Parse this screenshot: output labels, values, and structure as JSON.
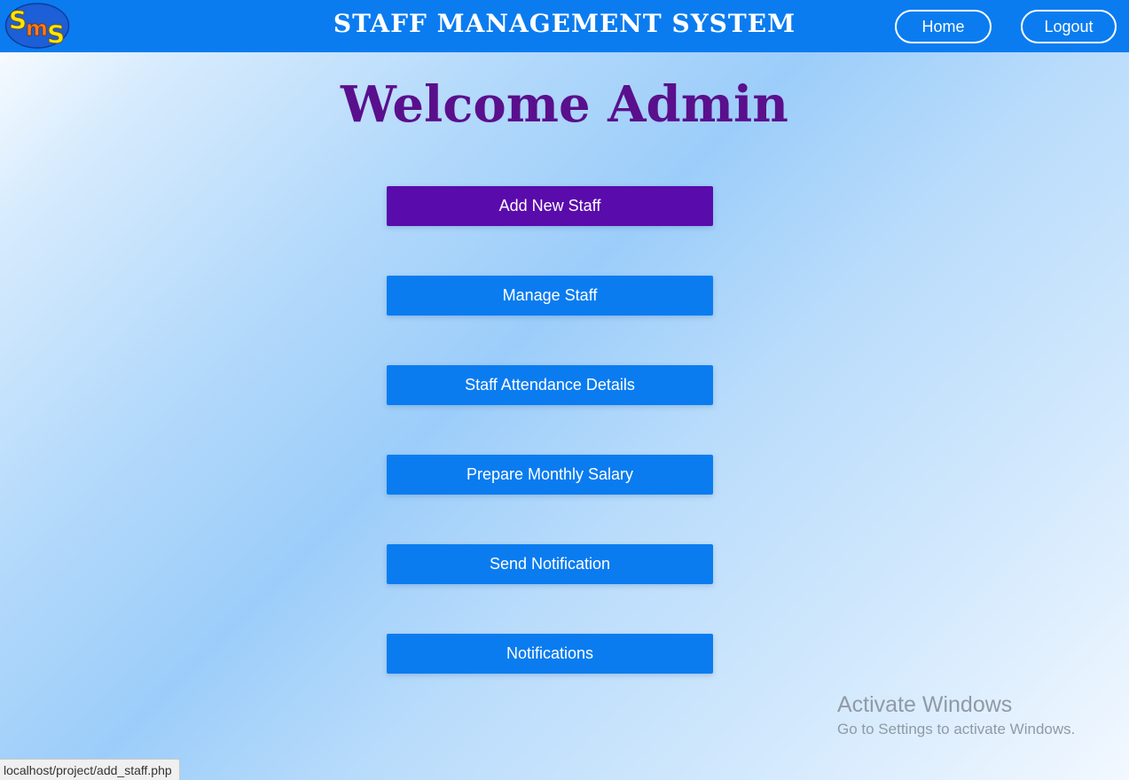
{
  "header": {
    "logo_text": "SMS",
    "title": "STAFF MANAGEMENT SYSTEM",
    "home_label": "Home",
    "logout_label": "Logout"
  },
  "main": {
    "welcome": "Welcome Admin",
    "menu": [
      {
        "label": "Add New Staff",
        "active": true
      },
      {
        "label": "Manage Staff",
        "active": false
      },
      {
        "label": "Staff Attendance Details",
        "active": false
      },
      {
        "label": "Prepare Monthly Salary",
        "active": false
      },
      {
        "label": "Send Notification",
        "active": false
      },
      {
        "label": "Notifications",
        "active": false
      }
    ]
  },
  "watermark": {
    "title": "Activate Windows",
    "subtitle": "Go to Settings to activate Windows."
  },
  "status_bar": {
    "url": "localhost/project/add_staff.php"
  },
  "colors": {
    "header_bg": "#0a7cf0",
    "button_bg": "#0a7cf0",
    "active_button_bg": "#5a0bab",
    "welcome_text": "#5a0f8d"
  }
}
